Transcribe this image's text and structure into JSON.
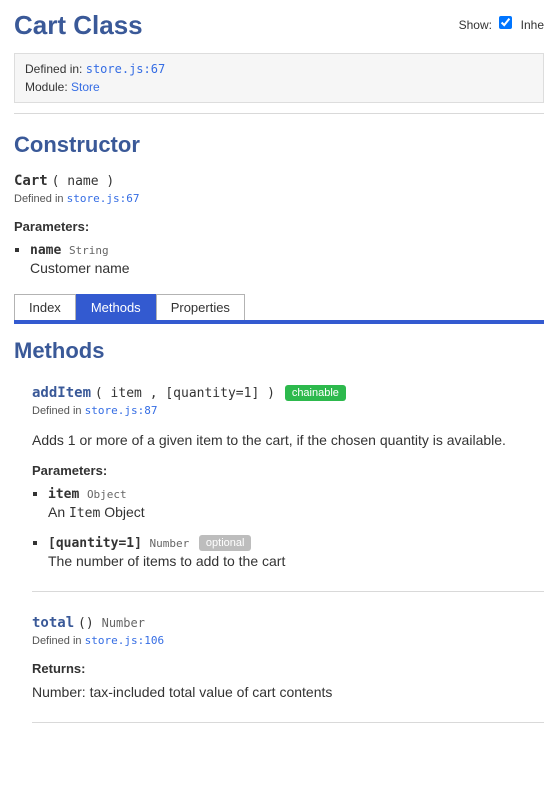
{
  "page": {
    "title": "Cart Class",
    "show_label": "Show:",
    "show_checkbox_label": "Inhe",
    "show_checked": true
  },
  "meta": {
    "defined_label": "Defined in:",
    "defined_link": "store.js:67",
    "module_label": "Module:",
    "module_link": "Store"
  },
  "constructor": {
    "heading": "Constructor",
    "name": "Cart",
    "signature": "( name )",
    "defined_label": "Defined in",
    "defined_link": "store.js:67",
    "params_heading": "Parameters:",
    "params": [
      {
        "name": "name",
        "type": "String",
        "desc": "Customer name"
      }
    ]
  },
  "tabs": {
    "items": [
      {
        "label": "Index",
        "active": false
      },
      {
        "label": "Methods",
        "active": true
      },
      {
        "label": "Properties",
        "active": false
      }
    ]
  },
  "methods": {
    "heading": "Methods",
    "items": [
      {
        "name": "addItem",
        "signature": "( item , [quantity=1] )",
        "badge": "chainable",
        "defined_label": "Defined in",
        "defined_link": "store.js:87",
        "description": "Adds 1 or more of a given item to the cart, if the chosen quantity is available.",
        "params_heading": "Parameters:",
        "params": [
          {
            "name": "item",
            "type": "Object",
            "desc_prefix": "An",
            "desc_code": "Item",
            "desc_suffix": "Object"
          },
          {
            "name": "[quantity=1]",
            "type": "Number",
            "optional_badge": "optional",
            "desc": "The number of items to add to the cart"
          }
        ]
      },
      {
        "name": "total",
        "signature": "()",
        "return_type": "Number",
        "defined_label": "Defined in",
        "defined_link": "store.js:106",
        "returns_heading": "Returns:",
        "returns_type": "Number:",
        "returns_desc": "tax-included total value of cart contents"
      }
    ]
  }
}
